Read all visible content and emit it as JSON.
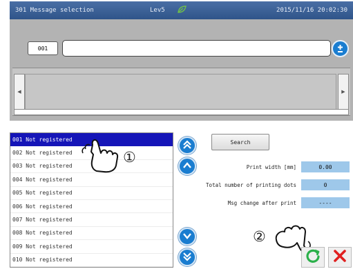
{
  "titlebar": {
    "title": "301 Message selection",
    "level": "Lev5",
    "datetime": "2015/11/16 20:02:30"
  },
  "message": {
    "number": "001",
    "text": ""
  },
  "list": {
    "items": [
      "001 Not registered",
      "002 Not registered",
      "003 Not registered",
      "004 Not registered",
      "005 Not registered",
      "006 Not registered",
      "007 Not registered",
      "008 Not registered",
      "009 Not registered",
      "010 Not registered"
    ],
    "selected_index": 0
  },
  "search": {
    "label": "Search"
  },
  "info": {
    "print_width_label": "Print width [mm]",
    "print_width_value": "0.00",
    "dots_label": "Total number of printing dots",
    "dots_value": "0",
    "msg_change_label": "Msg change after print",
    "msg_change_value": "----"
  },
  "callouts": {
    "step1": "①",
    "step2": "②"
  },
  "colors": {
    "titlebar": "#3a5f96",
    "selected_row": "#1515b8",
    "accent_blue": "#1a7dd0",
    "info_value_bg": "#9ec8ea",
    "ok_green": "#2bb04a",
    "cancel_red": "#e02020"
  },
  "icons": {
    "leaf": "leaf-icon",
    "plus_minus": "plus-minus-icon",
    "page_up": "double-chevron-up-icon",
    "line_up": "chevron-up-icon",
    "line_down": "chevron-down-icon",
    "page_down": "double-chevron-down-icon",
    "ok": "refresh-ok-icon",
    "cancel": "close-icon",
    "hand": "pointing-hand-icon"
  }
}
